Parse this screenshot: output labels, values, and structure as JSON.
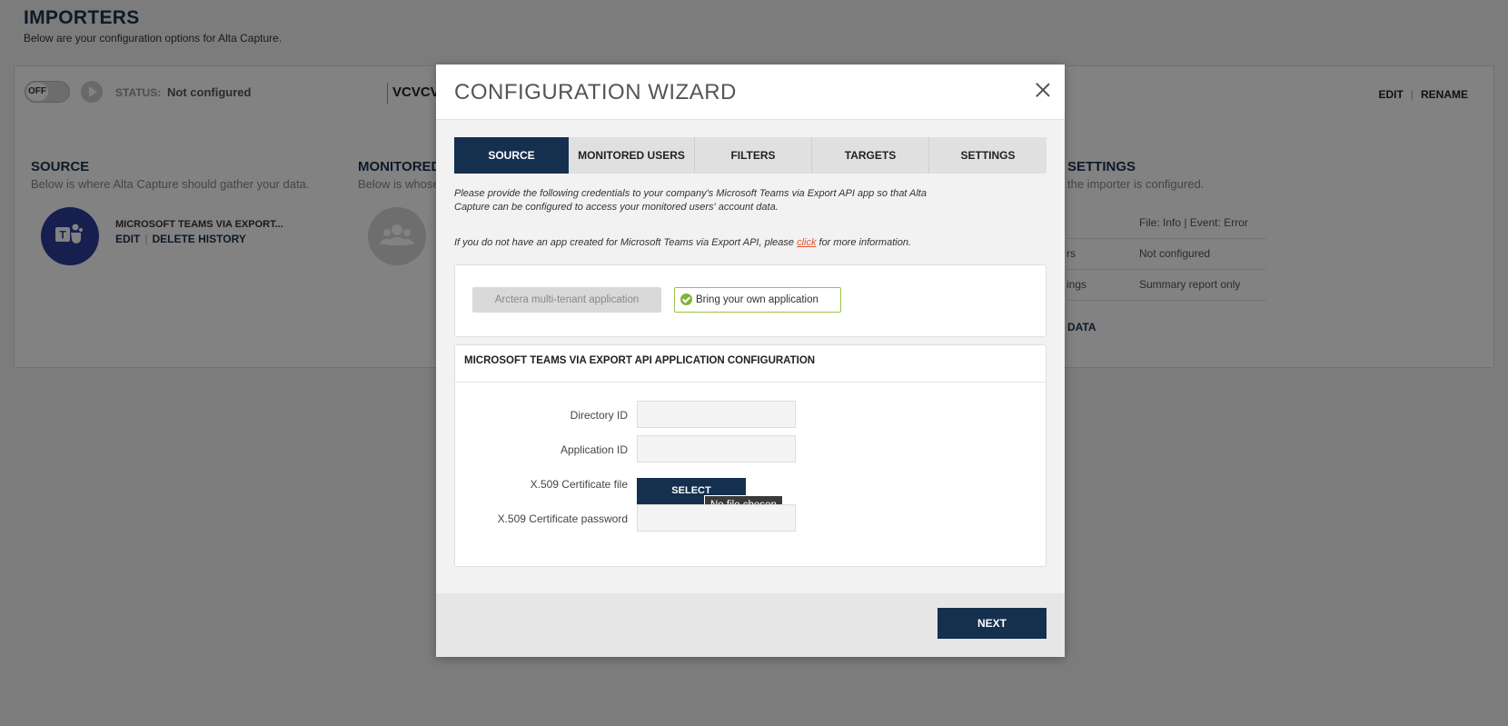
{
  "page": {
    "title": "IMPORTERS",
    "subtitle": "Below are your configuration options for Alta Capture."
  },
  "importer": {
    "toggle_label": "OFF",
    "status_label": "STATUS:",
    "status_value": "Not configured",
    "name": "VCVCV",
    "actions": {
      "edit": "EDIT",
      "rename": "RENAME"
    },
    "source": {
      "heading": "SOURCE",
      "sub": "Below is where Alta Capture should gather your data.",
      "name": "MICROSOFT TEAMS VIA EXPORT...",
      "edit": "EDIT",
      "delete_history": "DELETE HISTORY"
    },
    "monitored": {
      "heading": "MONITORED",
      "sub": "Below is whose"
    },
    "settings": {
      "heading": "SETTINGS",
      "sub": "the importer is configured.",
      "rows": [
        {
          "key": "",
          "value": "File: Info | Event: Error"
        },
        {
          "key": "rs",
          "value": "Not configured"
        },
        {
          "key": "ings",
          "value": "Summary report only"
        }
      ],
      "data_link": "DATA"
    }
  },
  "modal": {
    "title": "CONFIGURATION WIZARD",
    "tabs": [
      {
        "label": "SOURCE",
        "active": true
      },
      {
        "label": "MONITORED USERS",
        "active": false
      },
      {
        "label": "FILTERS",
        "active": false
      },
      {
        "label": "TARGETS",
        "active": false
      },
      {
        "label": "SETTINGS",
        "active": false
      }
    ],
    "intro": "Please provide the following credentials to your company's Microsoft Teams via Export API app so that Alta Capture can be configured to access your monitored users' account data.",
    "no_app_prefix": "If you do not have an app created for Microsoft Teams via Export API, please ",
    "no_app_link": "click",
    "no_app_suffix": " for more information.",
    "options": {
      "multi_tenant": "Arctera multi-tenant application",
      "own_app": "Bring your own application"
    },
    "config_title": "MICROSOFT TEAMS VIA EXPORT API APPLICATION CONFIGURATION",
    "fields": {
      "directory_id": {
        "label": "Directory ID",
        "value": ""
      },
      "application_id": {
        "label": "Application ID",
        "value": ""
      },
      "cert_file": {
        "label": "X.509 Certificate file",
        "button": "SELECT",
        "tooltip": "No file chosen"
      },
      "cert_password": {
        "label": "X.509 Certificate password",
        "value": ""
      }
    },
    "next": "NEXT"
  },
  "colors": {
    "navy": "#15304f",
    "teams": "#2e3d9b",
    "accent_green": "#7fb33a",
    "link": "#e2542b"
  }
}
